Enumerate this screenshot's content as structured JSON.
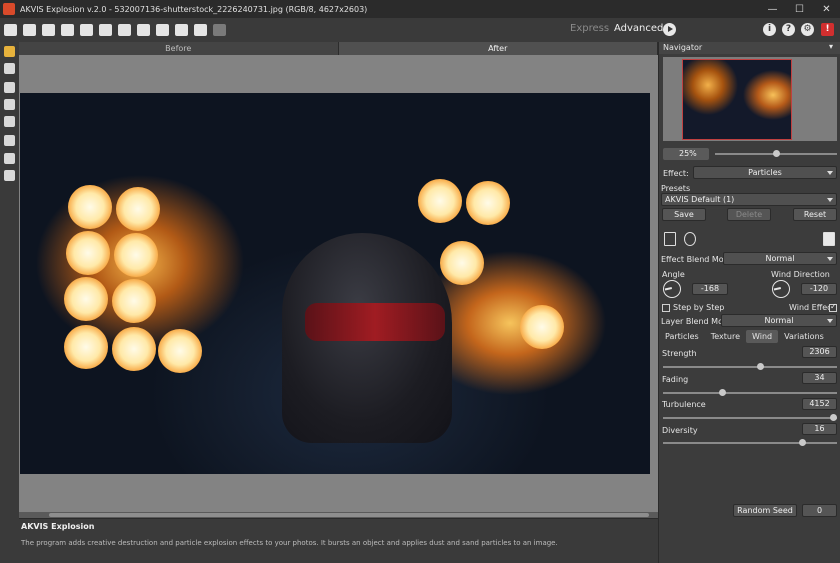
{
  "window": {
    "title": "AKVIS Explosion v.2.0 - 532007136-shutterstock_2226240731.jpg (RGB/8, 4627x2603)"
  },
  "modes": {
    "express": "Express",
    "advanced": "Advanced"
  },
  "canvas_tabs": {
    "before": "Before",
    "after": "After"
  },
  "info": {
    "title": "AKVIS Explosion",
    "description": "The program adds creative destruction and particle explosion effects to your photos. It bursts an object and applies dust and sand particles to an image."
  },
  "navigator": {
    "title": "Navigator",
    "zoom": "25%",
    "zoom_fraction": 0.5
  },
  "effect": {
    "label": "Effect:",
    "value": "Particles"
  },
  "presets": {
    "label": "Presets",
    "value": "AKVIS Default (1)",
    "save": "Save",
    "delete": "Delete",
    "reset": "Reset"
  },
  "effect_blend": {
    "label": "Effect Blend Mode",
    "value": "Normal"
  },
  "angle": {
    "label": "Angle",
    "value": "-168"
  },
  "wind_direction": {
    "label": "Wind Direction",
    "value": "-120"
  },
  "step_by_step": {
    "label": "Step by Step",
    "checked": false
  },
  "wind_effect": {
    "label": "Wind Effect",
    "checked": true
  },
  "layer_blend": {
    "label": "Layer Blend Mode",
    "value": "Normal"
  },
  "subtabs": [
    "Particles",
    "Texture",
    "Wind",
    "Variations"
  ],
  "active_subtab": "Wind",
  "params": {
    "strength": {
      "label": "Strength",
      "value": "2306",
      "fraction": 0.56
    },
    "fading": {
      "label": "Fading",
      "value": "34",
      "fraction": 0.34
    },
    "turbulence": {
      "label": "Turbulence",
      "value": "4152",
      "fraction": 0.98
    },
    "diversity": {
      "label": "Diversity",
      "value": "16",
      "fraction": 0.8
    }
  },
  "random_seed": {
    "label": "Random Seed",
    "value": "0"
  },
  "colors": {
    "accent": "#e7b23c",
    "brand_red": "#d12f2f"
  }
}
